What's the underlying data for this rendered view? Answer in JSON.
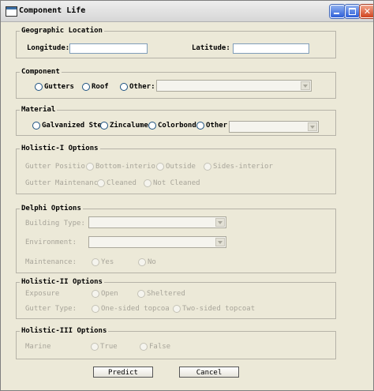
{
  "window": {
    "title": "Component Life"
  },
  "geographic": {
    "legend": "Geographic Location",
    "longitude_label": "Longitude:",
    "longitude_value": "",
    "latitude_label": "Latitude:",
    "latitude_value": ""
  },
  "component": {
    "legend": "Component",
    "options": [
      "Gutters",
      "Roof",
      "Other:"
    ],
    "other_value": ""
  },
  "material": {
    "legend": "Material",
    "options": [
      "Galvanized Ste",
      "Zincalume",
      "Colorbond",
      "Other:"
    ],
    "other_value": ""
  },
  "holistic1": {
    "legend": "Holistic-I Options",
    "gutter_position_label": "Gutter Positio",
    "gutter_position_options": [
      "Bottom-interio",
      "Outside",
      "Sides-interior"
    ],
    "gutter_maintenance_label": "Gutter Maintenanc",
    "gutter_maintenance_options": [
      "Cleaned",
      "Not Cleaned"
    ]
  },
  "delphi": {
    "legend": "Delphi Options",
    "building_type_label": "Building Type:",
    "building_type_value": "",
    "environment_label": "Environment:",
    "environment_value": "",
    "maintenance_label": "Maintenance:",
    "maintenance_options": [
      "Yes",
      "No"
    ]
  },
  "holistic2": {
    "legend": "Holistic-II Options",
    "exposure_label": "Exposure",
    "exposure_options": [
      "Open",
      "Sheltered"
    ],
    "gutter_type_label": "Gutter Type:",
    "gutter_type_options": [
      "One-sided topcoa",
      "Two-sided topcoat"
    ]
  },
  "holistic3": {
    "legend": "Holistic-III Options",
    "marine_label": "Marine",
    "marine_options": [
      "True",
      "False"
    ]
  },
  "buttons": {
    "predict": "Predict",
    "cancel": "Cancel"
  },
  "icons": {
    "app": "window-icon",
    "minimize": "minimize-icon",
    "maximize": "maximize-icon",
    "close": "close-icon"
  },
  "colors": {
    "titlebar_button": "#2e5fd8",
    "close_button": "#d0431e",
    "panel": "#ece9d8"
  }
}
